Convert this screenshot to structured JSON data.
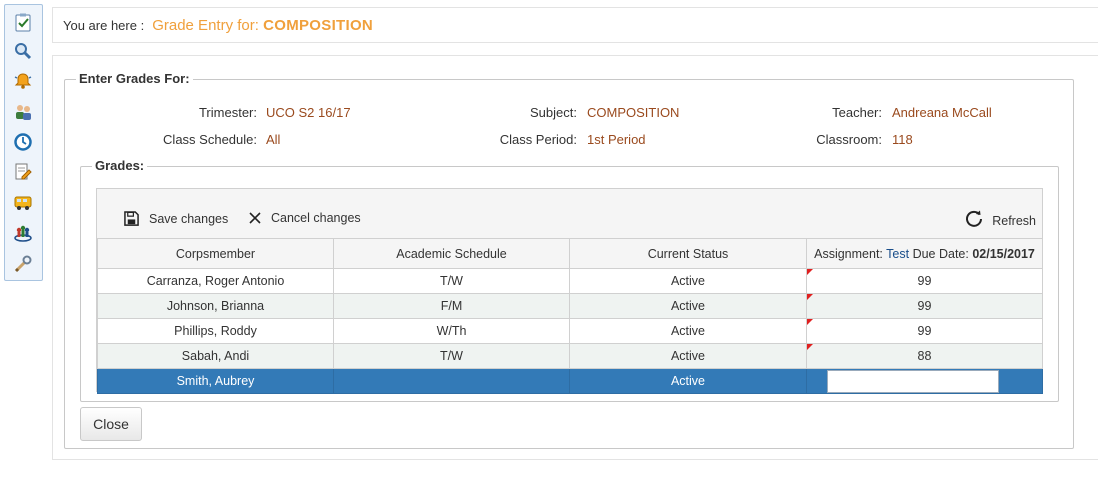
{
  "sidebar": {
    "icons": [
      "clipboard-check-icon",
      "search-icon",
      "alarm-bell-icon",
      "users-icon",
      "clock-icon",
      "edit-document-icon",
      "bus-icon",
      "group-icon",
      "tools-icon"
    ]
  },
  "breadcrumb": {
    "label": "You are here :",
    "prefix": "Grade Entry for:",
    "subject": "COMPOSITION"
  },
  "enter_grades": {
    "legend": "Enter Grades For:",
    "trimester_label": "Trimester:",
    "trimester": "UCO S2 16/17",
    "subject_label": "Subject:",
    "subject": "COMPOSITION",
    "teacher_label": "Teacher:",
    "teacher": "Andreana McCall",
    "schedule_label": "Class Schedule:",
    "schedule": "All",
    "period_label": "Class Period:",
    "period": "1st Period",
    "classroom_label": "Classroom:",
    "classroom": "118"
  },
  "grades": {
    "legend": "Grades:",
    "save_label": "Save changes",
    "cancel_label": "Cancel changes",
    "refresh_label": "Refresh",
    "columns": {
      "corpsmember": "Corpsmember",
      "schedule": "Academic Schedule",
      "status": "Current Status",
      "assignment_prefix": "Assignment:",
      "assignment_name": "Test",
      "due_prefix": "Due Date:",
      "due_date": "02/15/2017"
    },
    "rows": [
      {
        "name": "Carranza, Roger Antonio",
        "schedule": "T/W",
        "status": "Active",
        "grade": "99"
      },
      {
        "name": "Johnson, Brianna",
        "schedule": "F/M",
        "status": "Active",
        "grade": "99"
      },
      {
        "name": "Phillips, Roddy",
        "schedule": "W/Th",
        "status": "Active",
        "grade": "99"
      },
      {
        "name": "Sabah, Andi",
        "schedule": "T/W",
        "status": "Active",
        "grade": "88"
      },
      {
        "name": "Smith, Aubrey",
        "schedule": "",
        "status": "Active",
        "grade": ""
      }
    ]
  },
  "close_label": "Close",
  "colors": {
    "accent": "#f0a03c",
    "value": "#9a4a1e",
    "selected_row": "#337ab7",
    "dirty_flag": "#e02020"
  }
}
